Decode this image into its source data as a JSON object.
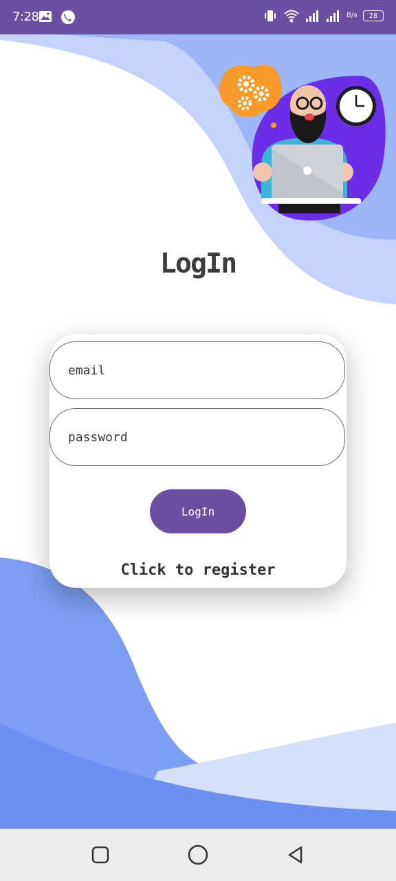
{
  "status_bar": {
    "time": "7:28",
    "battery": "28",
    "speed_unit": "B/s",
    "left_icons": [
      "image-icon",
      "phone-app-icon"
    ],
    "right_icons": [
      "vibrate-icon",
      "wifi-icon",
      "signal-icon",
      "signal-icon-2",
      "battery-icon"
    ]
  },
  "page": {
    "title": "LogIn"
  },
  "form": {
    "email_placeholder": "email",
    "password_placeholder": "password",
    "login_label": "LogIn",
    "register_label": "Click to register"
  },
  "nav": {
    "icons": [
      "recents-square-icon",
      "home-circle-icon",
      "back-triangle-icon"
    ]
  },
  "colors": {
    "accent": "#6a4fa3",
    "wave_light": "#c5d3fb",
    "wave_mid": "#93acf5",
    "wave_dark": "#6c90f1",
    "blob_purple": "#6b2ee6",
    "gear_orange": "#f89a2a"
  }
}
